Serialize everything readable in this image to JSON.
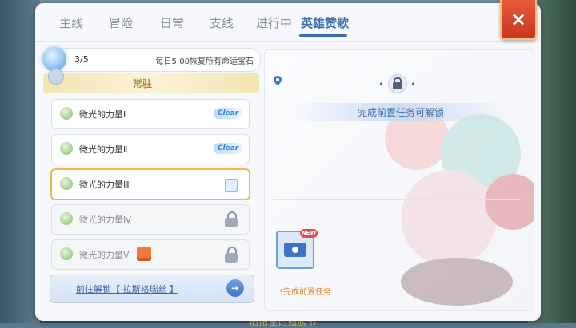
{
  "tabs": [
    {
      "label": "主线"
    },
    {
      "label": "冒险"
    },
    {
      "label": "日常"
    },
    {
      "label": "支线"
    },
    {
      "label": "进行中"
    },
    {
      "label": "英雄赞歌"
    }
  ],
  "active_tab": "英雄赞歌",
  "close_icon": "×",
  "gem_bar": {
    "count": "3/5",
    "info": "每日5:00恢复所有命运宝石"
  },
  "banner": {
    "label": "常驻"
  },
  "quests": [
    {
      "name": "微光的力量Ⅰ",
      "status": "Clear"
    },
    {
      "name": "微光的力量Ⅱ",
      "status": "Clear"
    },
    {
      "name": "微光的力量Ⅲ",
      "status": "selected"
    },
    {
      "name": "微光的力量Ⅳ",
      "status": "locked"
    },
    {
      "name": "微光的力量Ⅴ",
      "status": "locked"
    }
  ],
  "unlock_button": {
    "label": "前往解锁【 拉斯格瑞丝 】"
  },
  "detail": {
    "hint": "完成前置任务可解锁",
    "camera_badge": "NEW",
    "requirement": "*完成前置任务"
  },
  "background_text": "旧阳里的翅膀书"
}
